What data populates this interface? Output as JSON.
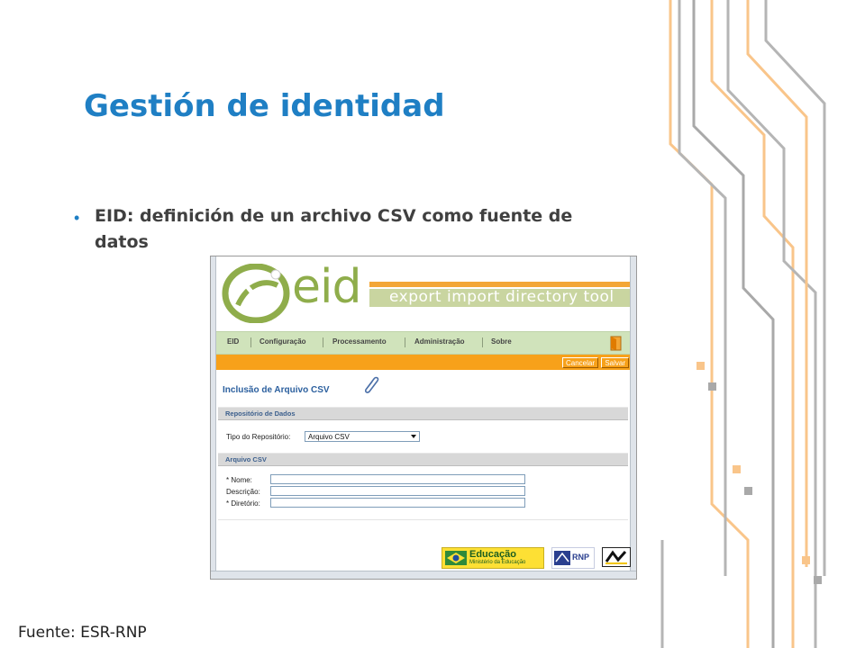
{
  "slide": {
    "title": "Gestión de identidad",
    "bullet": "EID: definición de un archivo CSV como fuente de datos",
    "source": "Fuente: ESR-RNP"
  },
  "app": {
    "logo_text": "eid",
    "tagline": "export import directory tool",
    "menu": [
      "EID",
      "Configuração",
      "Processamento",
      "Administração",
      "Sobre"
    ],
    "actions": {
      "cancel": "Cancelar",
      "save": "Salvar"
    },
    "page_title": "Inclusão de Arquivo CSV",
    "section_repo": "Repositório de Dados",
    "repo_type_label": "Tipo do Repositório:",
    "repo_type_value": "Arquivo CSV",
    "section_csv": "Arquivo CSV",
    "field_name_label": "* Nome:",
    "field_desc_label": "Descrição:",
    "field_dir_label": "* Diretório:",
    "field_name_value": "",
    "field_desc_value": "",
    "field_dir_value": "",
    "footer_educacao": "Educação",
    "footer_ministerio": "Ministério da Educação",
    "footer_rnp": "RNP"
  },
  "colors": {
    "title_blue": "#1f7fc4",
    "bullet_text": "#404040",
    "eid_green": "#8fad4b",
    "menu_green": "#d0e3bb",
    "action_orange": "#f7a11a",
    "deco_orange": "#f9c58a",
    "deco_gray": "#a9a9a9"
  },
  "icons": [
    "orbit-logo-icon",
    "exit-door-icon",
    "paperclip-icon",
    "brazil-flag-icon",
    "rnp-logo-icon",
    "rnp-ce-logo-icon"
  ]
}
